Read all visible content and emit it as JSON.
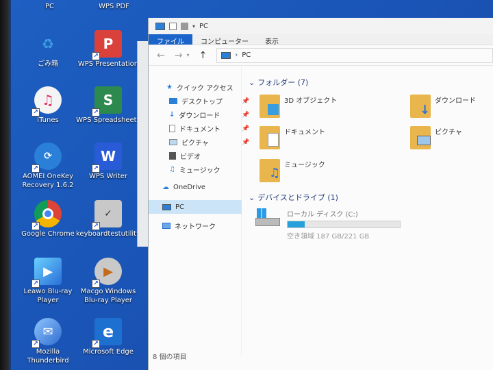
{
  "desktop": {
    "top_labels": [
      "PC",
      "WPS PDF"
    ],
    "icons": [
      {
        "label": "ごみ箱",
        "icon": "recycle-bin-icon",
        "color": "#3aa0e0"
      },
      {
        "label": "WPS Presentation",
        "icon": "wps-presentation-icon",
        "color": "#d9413a"
      },
      {
        "label": "iTunes",
        "icon": "itunes-icon",
        "color": "#f4f4f4"
      },
      {
        "label": "WPS Spreadsheets",
        "icon": "wps-spreadsheets-icon",
        "color": "#2d8a4e"
      },
      {
        "label": "AOMEI OneKey Recovery 1.6.2",
        "icon": "aomei-icon",
        "color": "#2a7fd8"
      },
      {
        "label": "WPS Writer",
        "icon": "wps-writer-icon",
        "color": "#2a5bd7"
      },
      {
        "label": "Google Chrome",
        "icon": "chrome-icon",
        "color": "#ffffff"
      },
      {
        "label": "keyboardtestutility",
        "icon": "keyboard-test-icon",
        "color": "#c8c8c8"
      },
      {
        "label": "Leawo Blu-ray Player",
        "icon": "leawo-icon",
        "color": "#3b7dd8"
      },
      {
        "label": "Macgo Windows Blu-ray Player",
        "icon": "macgo-icon",
        "color": "#c9c9c9"
      },
      {
        "label": "Mozilla Thunderbird",
        "icon": "thunderbird-icon",
        "color": "#2f6ecf"
      },
      {
        "label": "Microsoft Edge",
        "icon": "edge-icon",
        "color": "#1d6fd0"
      }
    ]
  },
  "explorer": {
    "title": "PC",
    "ribbon_tabs": [
      "ファイル",
      "コンピューター",
      "表示"
    ],
    "address": "PC",
    "nav": {
      "quick_access": "クイック アクセス",
      "items": [
        {
          "label": "デスクトップ",
          "pinned": true
        },
        {
          "label": "ダウンロード",
          "pinned": true
        },
        {
          "label": "ドキュメント",
          "pinned": true
        },
        {
          "label": "ピクチャ",
          "pinned": true
        },
        {
          "label": "ビデオ",
          "pinned": false
        },
        {
          "label": "ミュージック",
          "pinned": false
        }
      ],
      "onedrive": "OneDrive",
      "pc": "PC",
      "network": "ネットワーク"
    },
    "folders_title": "フォルダー (7)",
    "folders": [
      "3D オブジェクト",
      "ダウンロード",
      "ドキュメント",
      "ピクチャ",
      "ミュージック"
    ],
    "devices_title": "デバイスとドライブ (1)",
    "drive": {
      "name": "ローカル ディスク (C:)",
      "free": "空き領域 187 GB/221 GB",
      "used_fraction": 0.15
    },
    "status": "8 個の項目"
  },
  "colors": {
    "accent": "#1b64c9",
    "drive_fill": "#26a0da",
    "folder": "#e8b64c"
  }
}
